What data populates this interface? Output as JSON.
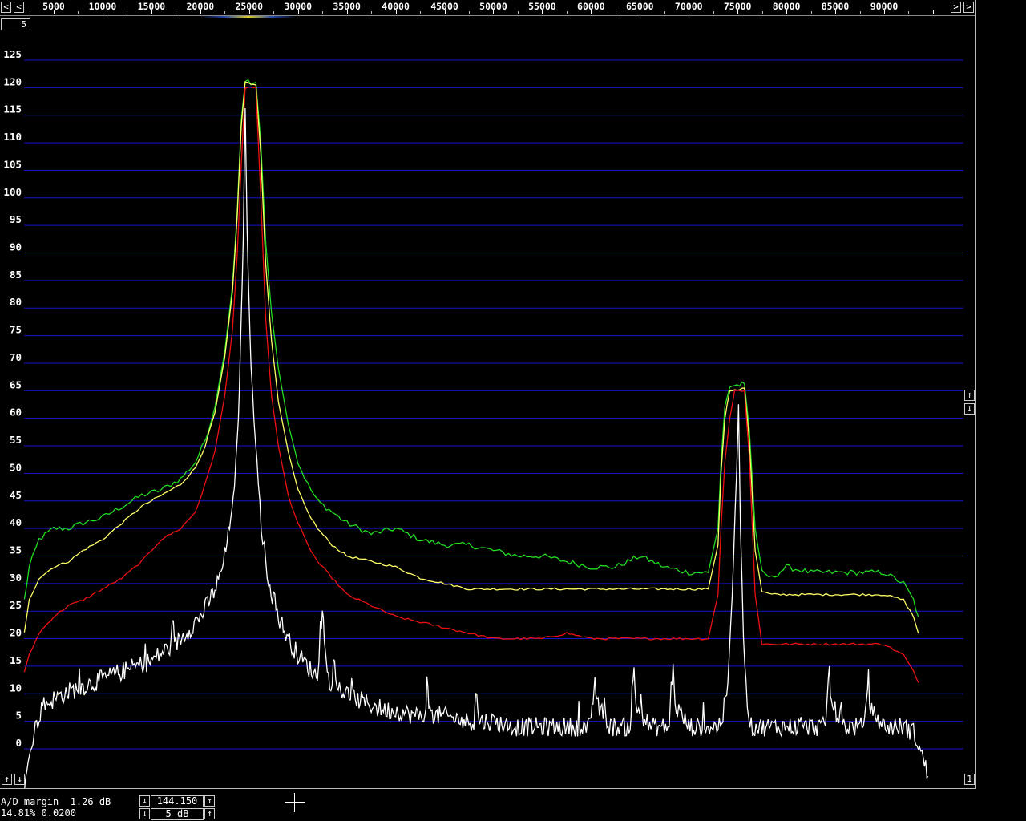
{
  "freq_axis": {
    "left_arrow": "<",
    "right_arrow": ">",
    "labels": [
      "5000",
      "10000",
      "15000",
      "20000",
      "25000",
      "30000",
      "35000",
      "40000",
      "45000",
      "50000",
      "55000",
      "60000",
      "65000",
      "70000",
      "75000",
      "80000",
      "85000",
      "90000"
    ]
  },
  "avg_count": "5",
  "side_buttons": {
    "up": "↑",
    "down": "↓",
    "one": "1"
  },
  "status": {
    "ad_margin": "A/D margin  1.26 dB",
    "stats": "14.81% 0.0200",
    "freq_value": "144.150",
    "db_step": "5 dB"
  },
  "colors": {
    "grid": "#1414c8",
    "green": "#22dd22",
    "yellow": "#ffff66",
    "red": "#ee1111",
    "white": "#ffffff"
  },
  "chart_data": {
    "type": "line",
    "xlabel": "",
    "ylabel": "",
    "xlim": [
      2000,
      95500
    ],
    "ylim": [
      -5,
      130
    ],
    "yticks": [
      0,
      5,
      10,
      15,
      20,
      25,
      30,
      35,
      40,
      45,
      50,
      55,
      60,
      65,
      70,
      75,
      80,
      85,
      90,
      95,
      100,
      105,
      110,
      115,
      120,
      125
    ],
    "xticks": [
      5000,
      10000,
      15000,
      20000,
      25000,
      30000,
      35000,
      40000,
      45000,
      50000,
      55000,
      60000,
      65000,
      70000,
      75000,
      80000,
      85000,
      90000
    ],
    "series": [
      {
        "color": "green",
        "x": [
          2000,
          2500,
          3500,
          5000,
          6500,
          8000,
          10000,
          12000,
          14000,
          16000,
          18000,
          19500,
          20500,
          21500,
          22500,
          23300,
          23800,
          24200,
          24600,
          25200,
          25700,
          26200,
          26700,
          27300,
          28000,
          29000,
          30000,
          31000,
          32000,
          33500,
          35000,
          37500,
          40000,
          42500,
          45000,
          47500,
          50000,
          52500,
          55000,
          57500,
          60000,
          62500,
          65000,
          67500,
          70000,
          72000,
          73000,
          73300,
          73700,
          74200,
          74700,
          75200,
          75700,
          76200,
          76800,
          77500,
          78500,
          80000,
          82500,
          85000,
          87500,
          90000,
          92000,
          93000,
          93500
        ],
        "y": [
          27,
          33,
          38,
          40,
          40,
          41,
          42,
          44,
          46,
          47,
          49,
          52,
          56,
          62,
          72,
          84,
          98,
          114,
          121.5,
          121,
          121,
          110,
          92,
          79,
          69,
          59,
          52,
          48,
          45,
          43,
          41,
          39,
          40,
          38,
          37,
          37,
          36,
          35,
          35,
          34,
          33,
          33,
          35,
          33,
          32,
          32,
          40,
          52,
          62,
          65.8,
          66,
          66,
          66.3,
          58,
          40,
          32,
          31,
          33,
          32,
          32,
          32,
          32,
          30,
          27,
          24
        ]
      },
      {
        "color": "yellow",
        "x": [
          2000,
          2500,
          3500,
          5000,
          6500,
          8000,
          10000,
          12000,
          14000,
          16000,
          18000,
          19500,
          20500,
          21500,
          22500,
          23300,
          23800,
          24200,
          24600,
          25200,
          25700,
          26200,
          26700,
          27300,
          28000,
          29000,
          30000,
          31000,
          32000,
          33500,
          35000,
          37500,
          40000,
          42500,
          45000,
          47500,
          50000,
          52500,
          55000,
          57500,
          60000,
          62500,
          65000,
          67500,
          70000,
          72000,
          73000,
          73300,
          73700,
          74200,
          74700,
          75200,
          75700,
          76200,
          76800,
          77500,
          78500,
          80000,
          82500,
          85000,
          87500,
          90000,
          92000,
          93000,
          93500
        ],
        "y": [
          21,
          27,
          31,
          33,
          34,
          36,
          38,
          41,
          44,
          46,
          48,
          51,
          55,
          61,
          71,
          83,
          97,
          113,
          121,
          120.5,
          120.5,
          108,
          88,
          74,
          63,
          54,
          47,
          43,
          40,
          37,
          35,
          34,
          33,
          31,
          30,
          29,
          29,
          29,
          29,
          29,
          29,
          29,
          29,
          29,
          29,
          29,
          37,
          50,
          60,
          65,
          65.2,
          65.2,
          65.5,
          56,
          36,
          28.5,
          28,
          28,
          28,
          28,
          28,
          28,
          27,
          24,
          21
        ]
      },
      {
        "color": "red",
        "x": [
          2000,
          2500,
          3500,
          5000,
          6500,
          8000,
          10000,
          12000,
          14000,
          16000,
          18000,
          19500,
          20500,
          21500,
          22500,
          23300,
          23800,
          24200,
          24600,
          25200,
          25700,
          26200,
          26700,
          27300,
          28000,
          29000,
          30000,
          31000,
          32000,
          33500,
          35000,
          37500,
          40000,
          42500,
          45000,
          47500,
          50000,
          52500,
          55000,
          57500,
          60000,
          62500,
          65000,
          67500,
          70000,
          72000,
          73000,
          73300,
          73700,
          74200,
          74700,
          75200,
          75700,
          76200,
          76800,
          77500,
          78500,
          80000,
          82500,
          85000,
          87500,
          90000,
          92000,
          93000,
          93500
        ],
        "y": [
          14,
          17,
          21,
          24,
          26,
          27,
          29,
          31,
          34,
          38,
          40,
          43,
          48,
          54,
          64,
          76,
          90,
          106,
          120,
          120,
          120,
          100,
          78,
          64,
          55,
          46,
          41,
          37,
          34,
          31,
          28,
          26,
          24,
          23,
          22,
          21,
          20,
          20,
          20,
          21,
          20,
          20,
          20,
          20,
          20,
          20,
          28,
          40,
          52,
          60,
          65,
          65,
          65,
          53,
          28,
          19,
          19,
          19,
          19,
          19,
          19,
          19,
          17,
          14,
          12
        ]
      },
      {
        "color": "white",
        "x": [
          2000,
          2500,
          3000,
          3500,
          4000,
          5000,
          6000,
          7500,
          9000,
          10500,
          12000,
          13500,
          15000,
          16500,
          17500,
          18000,
          18500,
          19000,
          19500,
          20000,
          21000,
          22000,
          22500,
          23000,
          23500,
          23800,
          24000,
          24200,
          24400,
          24600,
          24800,
          25000,
          25200,
          25500,
          25800,
          26100,
          26400,
          26700,
          27000,
          27500,
          28000,
          29000,
          30000,
          31000,
          32000,
          32300,
          32500,
          32700,
          33000,
          34000,
          35000,
          36000,
          37500,
          39000,
          40000,
          42000,
          43000,
          43200,
          43400,
          43600,
          45000,
          47000,
          48000,
          48200,
          48400,
          48600,
          50000,
          52000,
          54000,
          56000,
          58000,
          60000,
          60200,
          60400,
          60600,
          62000,
          64000,
          64200,
          64400,
          64600,
          66000,
          68000,
          68200,
          68400,
          68600,
          70000,
          72000,
          73000,
          73500,
          74000,
          74300,
          74600,
          74900,
          75100,
          75300,
          75600,
          76000,
          76400,
          77000,
          78000,
          80000,
          82000,
          84000,
          84200,
          84400,
          84600,
          86000,
          88000,
          88200,
          88400,
          88600,
          90000,
          92000,
          93000,
          93500,
          94000,
          94500
        ],
        "y": [
          -7,
          0,
          3,
          6,
          8,
          9,
          10,
          11,
          12,
          13,
          14,
          15,
          16,
          18,
          19,
          20,
          21,
          22,
          23,
          24,
          27,
          31,
          35,
          40,
          48,
          56,
          65,
          78,
          92,
          116,
          95,
          80,
          70,
          60,
          52,
          44,
          38,
          34,
          31,
          27,
          24,
          20,
          17,
          15,
          13,
          20,
          26,
          20,
          13,
          11,
          10,
          9,
          8,
          7,
          7,
          6,
          6,
          12,
          8,
          6,
          6,
          5,
          5,
          11,
          7,
          5,
          5,
          4,
          4,
          4,
          4,
          4,
          9,
          13,
          8,
          4,
          4,
          10,
          14,
          8,
          4,
          4,
          11,
          15,
          8,
          4,
          4,
          4,
          6,
          12,
          22,
          35,
          50,
          63,
          40,
          20,
          8,
          4,
          4,
          4,
          4,
          4,
          4,
          11,
          14,
          8,
          4,
          4,
          10,
          13,
          7,
          4,
          4,
          3,
          1,
          -2,
          -5
        ]
      }
    ]
  }
}
